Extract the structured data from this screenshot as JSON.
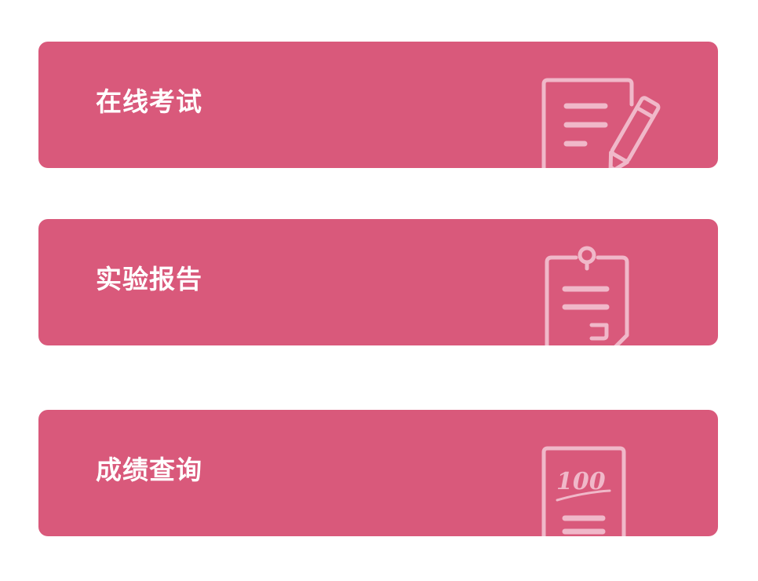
{
  "theme": {
    "card_color": "#d9597b",
    "icon_color": "#f0b8c9"
  },
  "cards": [
    {
      "label": "在线考试",
      "icon": "exam-paper-pencil-icon"
    },
    {
      "label": "实验报告",
      "icon": "clipboard-report-icon"
    },
    {
      "label": "成绩查询",
      "icon": "score-100-sheet-icon"
    }
  ]
}
